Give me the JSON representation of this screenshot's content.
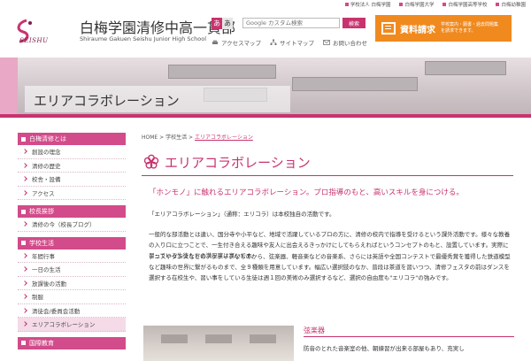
{
  "top_links": [
    "学校法人 白梅学園",
    "白梅学園大学",
    "白梅学園高等学校",
    "白梅幼稚園"
  ],
  "logo": {
    "en": "SEISHU",
    "title": "白梅学園清修中高一貫部",
    "subtitle": "Shiraume Gakuen Seishu Junior High School"
  },
  "font_size": {
    "a1": "あ",
    "a2": "あ"
  },
  "search": {
    "placeholder": "Google カスタム検索",
    "button": "検索"
  },
  "sub_links": [
    "アクセスマップ",
    "サイトマップ",
    "お問い合わせ"
  ],
  "request": {
    "title": "資料請求",
    "desc": "学校案内・願書・過去問題集\nを請求できます。"
  },
  "banner": {
    "title": "エリアコラボレーション"
  },
  "sidebar": {
    "groups": [
      {
        "title": "白梅清修とは",
        "items": [
          "創設の理念",
          "清修の歴史",
          "校舎・設備",
          "アクセス"
        ]
      },
      {
        "title": "校長挨拶",
        "items": [
          "清修の今（校長ブログ）"
        ]
      },
      {
        "title": "学校生活",
        "items": [
          "年間行事",
          "一日の生活",
          "放課後の活動",
          "制服",
          "清徒会/委員会活動",
          "エリアコラボレーション"
        ]
      },
      {
        "title": "国際教育",
        "items": []
      }
    ]
  },
  "breadcrumb": {
    "home": "HOME",
    "sep": ">",
    "parent": "学校生活",
    "current": "エリアコラボレーション"
  },
  "page": {
    "title": "エリアコラボレーション",
    "lead": "「ホンモノ」に触れるエリアコラボレーション。プロ指導のもと、高いスキルを身につける。",
    "p1": "「エリアコラボレーション」（通称：エリコラ）は本校独自の活動です。",
    "p2": "一般的な部活動とは違い、国分寺や小平など、地域で活躍しているプロの方に、清修の校内で指導を受けるという課外活動です。様々な教養の入り口に立つことで、一生付き合える趣味や友人に出会えるきっかけにしてもらえればというコンセプトのもと、設置しています。実際に習っている生徒たちの満足度は高いです。",
    "p3": "テニスやダンスなどのアクティブなものから、弦楽器、軽音楽などの音楽系、さらには英語や全国コンテストで最優秀賞を獲得した鉄道模型など趣味の世界に繋がるものまで、全９種類を用意しています。幅広い選択肢のなか、普段は茶道を習いつつ、清修フェスタの前はダンスを選択する在校生や、習い事をしている生徒は週１回の美術のみ選択するなど、選択の自由度も\"エリコラ\"の強みです。",
    "section_title": "弦楽器",
    "section_text": "防音のとれた音楽室の他、朝練習が出来る部屋もあり、充実し"
  },
  "colors": {
    "accent": "#c8336f",
    "orange": "#f08a1f",
    "sidebar_header": "#d24b8a"
  }
}
